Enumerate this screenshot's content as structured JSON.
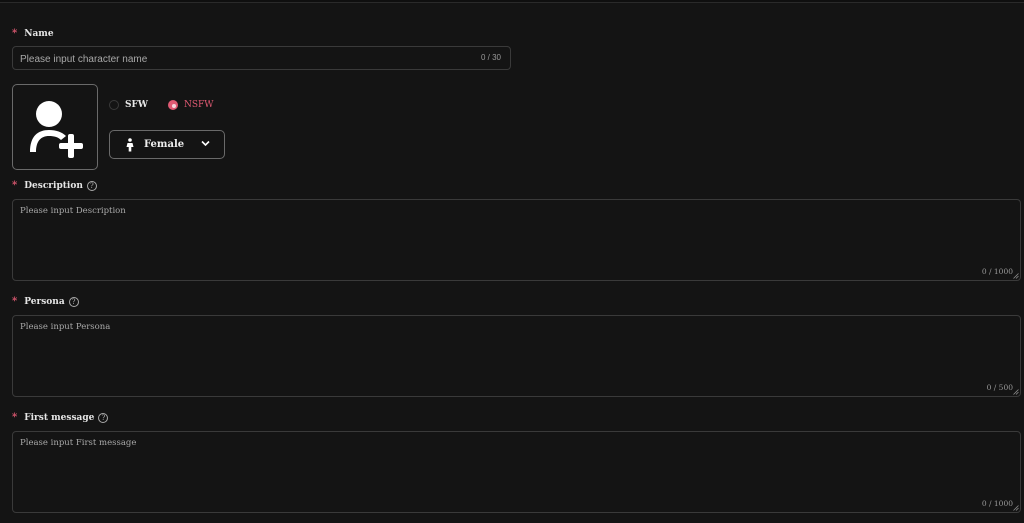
{
  "form": {
    "name": {
      "label": "Name",
      "required_mark": "*",
      "placeholder": "Please input character name",
      "counter": "0 / 30"
    },
    "avatar": {
      "icon": "add-user-icon"
    },
    "rating": {
      "options": [
        {
          "label": "SFW",
          "checked": false
        },
        {
          "label": "NSFW",
          "checked": true
        }
      ]
    },
    "gender": {
      "value": "Female",
      "icon": "female-person-icon"
    },
    "description": {
      "label": "Description",
      "required_mark": "*",
      "placeholder": "Please input Description",
      "counter": "0 / 1000"
    },
    "persona": {
      "label": "Persona",
      "required_mark": "*",
      "placeholder": "Please input Persona",
      "counter": "0 / 500"
    },
    "first_message": {
      "label": "First message",
      "required_mark": "*",
      "placeholder": "Please input First message",
      "counter": "0 / 1000"
    }
  },
  "colors": {
    "accent": "#e05a73",
    "background": "#141414",
    "border": "#3a3a3a"
  }
}
